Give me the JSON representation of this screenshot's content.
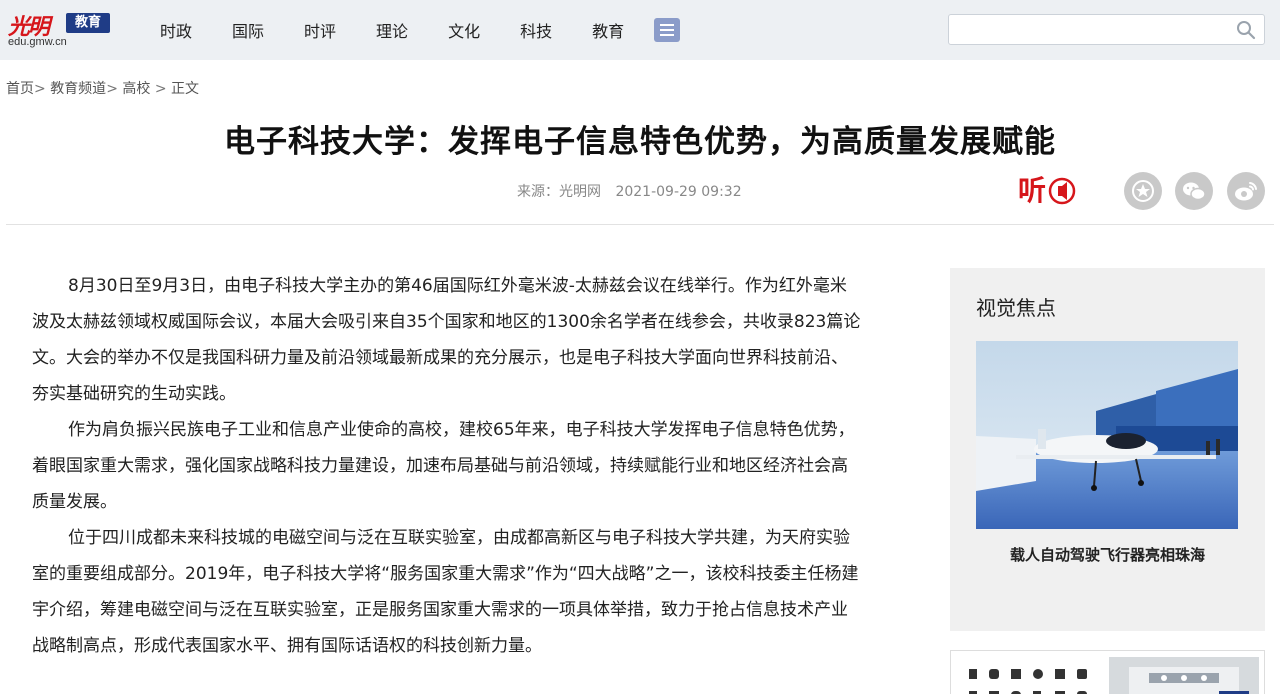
{
  "header": {
    "logo_text": "光明",
    "logo_badge": "教育",
    "logo_url": "edu.gmw.cn",
    "nav": [
      "时政",
      "国际",
      "时评",
      "理论",
      "文化",
      "科技",
      "教育"
    ],
    "search_placeholder": ""
  },
  "breadcrumb": {
    "items": [
      "首页",
      "教育频道",
      "高校",
      "正文"
    ],
    "seps": [
      ">",
      ">",
      ">"
    ]
  },
  "article": {
    "title": "电子科技大学：发挥电子信息特色优势，为高质量发展赋能",
    "source": "来源：光明网",
    "datetime": "2021-09-29 09:32",
    "listen_label": "听",
    "paragraphs": [
      "8月30日至9月3日，由电子科技大学主办的第46届国际红外毫米波-太赫兹会议在线举行。作为红外毫米波及太赫兹领域权威国际会议，本届大会吸引来自35个国家和地区的1300余名学者在线参会，共收录823篇论文。大会的举办不仅是我国科研力量及前沿领域最新成果的充分展示，也是电子科技大学面向世界科技前沿、夯实基础研究的生动实践。",
      "作为肩负振兴民族电子工业和信息产业使命的高校，建校65年来，电子科技大学发挥电子信息特色优势，着眼国家重大需求，强化国家战略科技力量建设，加速布局基础与前沿领域，持续赋能行业和地区经济社会高质量发展。",
      "位于四川成都未来科技城的电磁空间与泛在互联实验室，由成都高新区与电子科技大学共建，为天府实验室的重要组成部分。2019年，电子科技大学将“服务国家重大需求”作为“四大战略”之一，该校科技委主任杨建宇介绍，筹建电磁空间与泛在互联实验室，正是服务国家重大需求的一项具体举措，致力于抢占信息技术产业战略制高点，形成代表国家水平、拥有国际话语权的科技创新力量。"
    ]
  },
  "sidebar": {
    "title": "视觉焦点",
    "caption": "载人自动驾驶飞行器亮相珠海"
  },
  "colors": {
    "brand_red": "#d6161b",
    "badge_blue": "#1f3c86",
    "topbar_bg": "#edf0f3",
    "sidebar_bg": "#f0f0f0"
  },
  "icons": [
    "menu-icon",
    "search-icon",
    "listen-icon",
    "star-icon",
    "wechat-icon",
    "weibo-icon"
  ]
}
